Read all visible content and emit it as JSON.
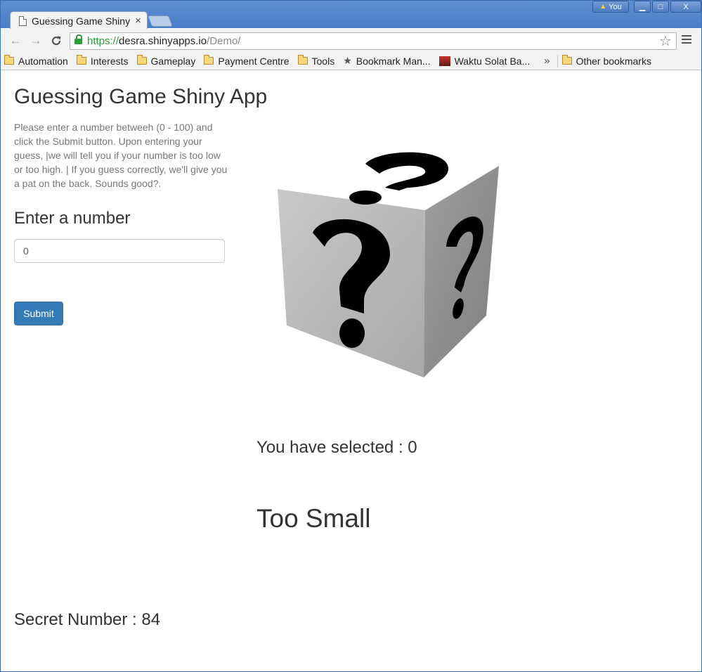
{
  "browser": {
    "tab_title": "Guessing Game Shiny App",
    "tab_close": "×",
    "profile_name": "You",
    "window_controls": {
      "minimize": "▁",
      "maximize": "□",
      "close": "X"
    },
    "nav": {
      "back": "←",
      "forward": "→",
      "reload": "C"
    },
    "url": {
      "scheme": "https://",
      "host": "desra.shinyapps.io",
      "path": "/Demo/"
    },
    "star_icon": "☆",
    "bookmarks": [
      {
        "label": "Automation",
        "icon": "folder-icon"
      },
      {
        "label": "Interests",
        "icon": "folder-icon"
      },
      {
        "label": "Gameplay",
        "icon": "folder-icon"
      },
      {
        "label": "Payment Centre",
        "icon": "folder-icon"
      },
      {
        "label": "Tools",
        "icon": "folder-icon"
      },
      {
        "label": "Bookmark Man...",
        "icon": "star-icon"
      },
      {
        "label": "Waktu Solat Ba...",
        "icon": "site-favicon"
      }
    ],
    "bookmarks_overflow": "»",
    "other_bookmarks": "Other bookmarks"
  },
  "app": {
    "title": "Guessing Game Shiny App",
    "instructions": "Please enter a number betweeh (0 - 100) and click the Submit button. Upon entering your guess, |we will tell you if your number is too low or too high. | If you guess correctly, we'll give you a pat on the back. Sounds good?.",
    "input_label": "Enter a number",
    "input_value": "0",
    "submit_label": "Submit",
    "selected_text": "You have selected : 0",
    "result_text": "Too Small",
    "secret_text": "Secret Number : 84"
  },
  "colors": {
    "url_scheme": "#2e9b3a",
    "button_primary": "#337ab7",
    "titlebar": "#4a7ec7"
  }
}
